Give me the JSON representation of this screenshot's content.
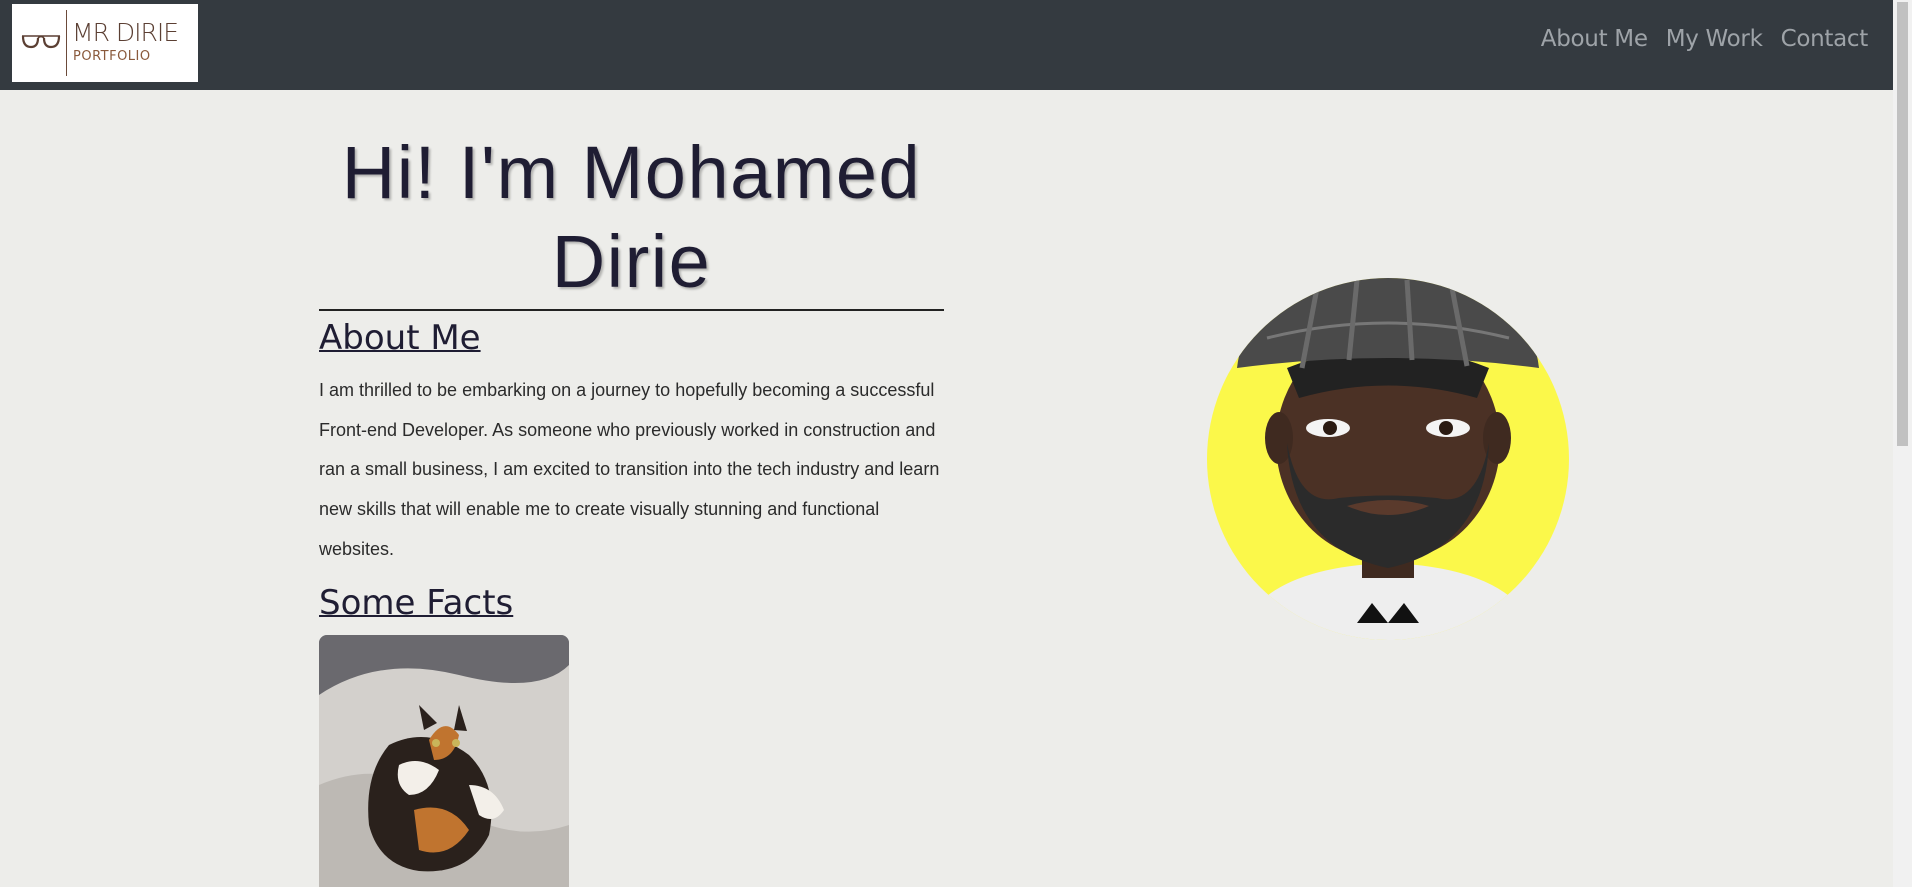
{
  "logo": {
    "title": "MR DIRIE",
    "subtitle": "PORTFOLIO"
  },
  "nav": {
    "links": [
      "About Me",
      "My Work",
      "Contact"
    ]
  },
  "hero": {
    "title": "Hi! I'm Mohamed Dirie"
  },
  "about": {
    "heading": "About Me",
    "text": "I am thrilled to be embarking on a journey to hopefully becoming a successful Front-end Developer. As someone who previously worked in construction and ran a small business, I am excited to transition into the tech industry and learn new skills that will enable me to create visually stunning and functional websites."
  },
  "facts": {
    "heading": "Some Facts"
  },
  "colors": {
    "navbar": "#343a40",
    "background": "#ededea",
    "heading": "#1f1d33",
    "nav_link": "#9ea3a8",
    "avatar_bg": "#fbf84a"
  }
}
